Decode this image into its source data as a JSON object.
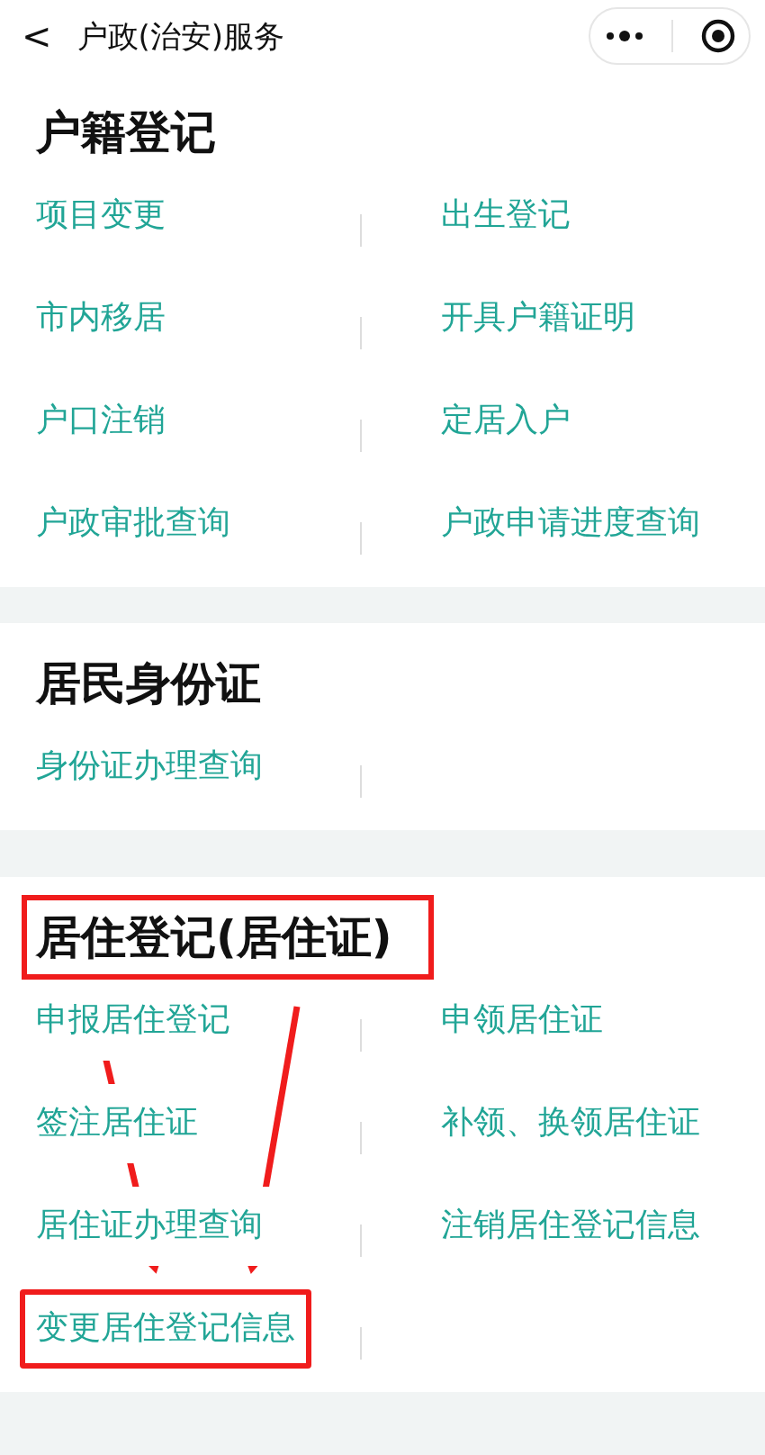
{
  "nav": {
    "back": "<",
    "title": "户政(治安)服务"
  },
  "sections": [
    {
      "title": "户籍登记",
      "title_highlighted": false,
      "items": [
        {
          "label": "项目变更",
          "highlighted": false
        },
        {
          "label": "出生登记",
          "highlighted": false
        },
        {
          "label": "市内移居",
          "highlighted": false
        },
        {
          "label": "开具户籍证明",
          "highlighted": false
        },
        {
          "label": "户口注销",
          "highlighted": false
        },
        {
          "label": "定居入户",
          "highlighted": false
        },
        {
          "label": "户政审批查询",
          "highlighted": false
        },
        {
          "label": "户政申请进度查询",
          "highlighted": false
        }
      ]
    },
    {
      "title": "居民身份证",
      "title_highlighted": false,
      "items": [
        {
          "label": "身份证办理查询",
          "highlighted": false
        }
      ]
    },
    {
      "title": "居住登记(居住证)",
      "title_highlighted": true,
      "items": [
        {
          "label": "申报居住登记",
          "highlighted": false
        },
        {
          "label": "申领居住证",
          "highlighted": false
        },
        {
          "label": "签注居住证",
          "highlighted": false
        },
        {
          "label": "补领、换领居住证",
          "highlighted": false
        },
        {
          "label": "居住证办理查询",
          "highlighted": false
        },
        {
          "label": "注销居住登记信息",
          "highlighted": false
        },
        {
          "label": "变更居住登记信息",
          "highlighted": true
        }
      ]
    }
  ]
}
